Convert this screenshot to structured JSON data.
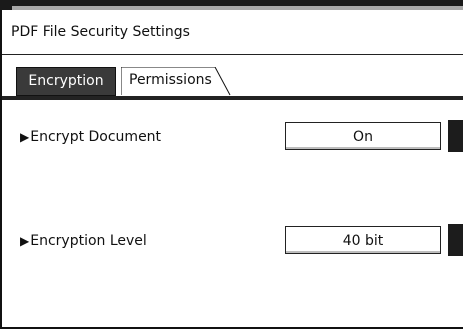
{
  "window": {
    "title": "PDF File Security Settings"
  },
  "tabs": [
    {
      "label": "Encryption",
      "active": true
    },
    {
      "label": "Permissions",
      "active": false
    }
  ],
  "settings": [
    {
      "label": "Encrypt Document",
      "value": "On"
    },
    {
      "label": "Encryption Level",
      "value": "40 bit"
    }
  ],
  "icons": {
    "row_marker": "triangle-right-icon"
  },
  "colors": {
    "active_tab_bg": "#3a3a3a",
    "frame": "#111111",
    "background": "#ffffff"
  }
}
